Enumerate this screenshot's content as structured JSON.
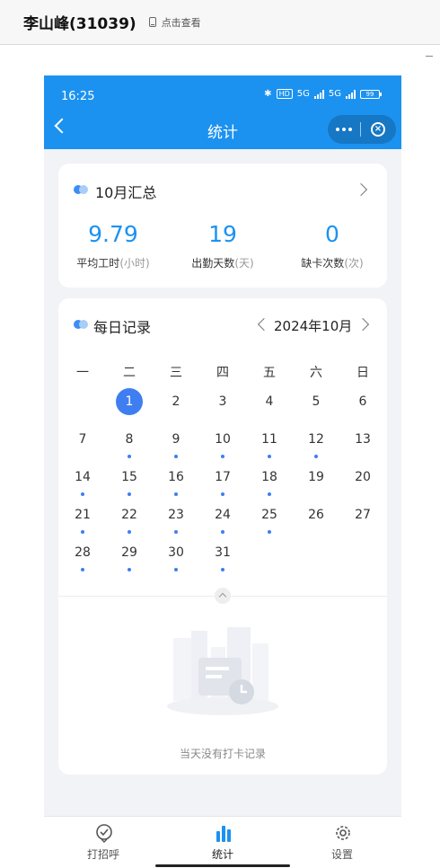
{
  "host": {
    "user_name": "李山峰(31039)",
    "view_label": "点击查看"
  },
  "status_bar": {
    "time": "16:25",
    "network": "5G",
    "battery": "99"
  },
  "nav": {
    "title": "统计"
  },
  "summary": {
    "title": "10月汇总",
    "stats": [
      {
        "value": "9.79",
        "label": "平均工时",
        "unit": "(小时)"
      },
      {
        "value": "19",
        "label": "出勤天数",
        "unit": "(天)"
      },
      {
        "value": "0",
        "label": "缺卡次数",
        "unit": "(次)"
      }
    ]
  },
  "daily": {
    "title": "每日记录",
    "month": "2024年10月",
    "weekdays": [
      "一",
      "二",
      "三",
      "四",
      "五",
      "六",
      "日"
    ],
    "selected_day": "1",
    "days": [
      "1",
      "2",
      "3",
      "4",
      "5",
      "6",
      "7",
      "8",
      "9",
      "10",
      "11",
      "12",
      "13",
      "14",
      "15",
      "16",
      "17",
      "18",
      "19",
      "20",
      "21",
      "22",
      "23",
      "24",
      "25",
      "26",
      "27",
      "28",
      "29",
      "30",
      "31"
    ],
    "record_days": [
      "8",
      "9",
      "10",
      "11",
      "12",
      "14",
      "15",
      "16",
      "17",
      "18",
      "21",
      "22",
      "23",
      "24",
      "25",
      "28",
      "29",
      "30",
      "31"
    ],
    "empty_text": "当天没有打卡记录"
  },
  "tabs": [
    {
      "label": "打招呼",
      "icon": "check-circle-icon"
    },
    {
      "label": "统计",
      "icon": "bar-chart-icon"
    },
    {
      "label": "设置",
      "icon": "gear-icon"
    }
  ],
  "colors": {
    "primary": "#1c92f0",
    "accent": "#3f7ef0"
  }
}
